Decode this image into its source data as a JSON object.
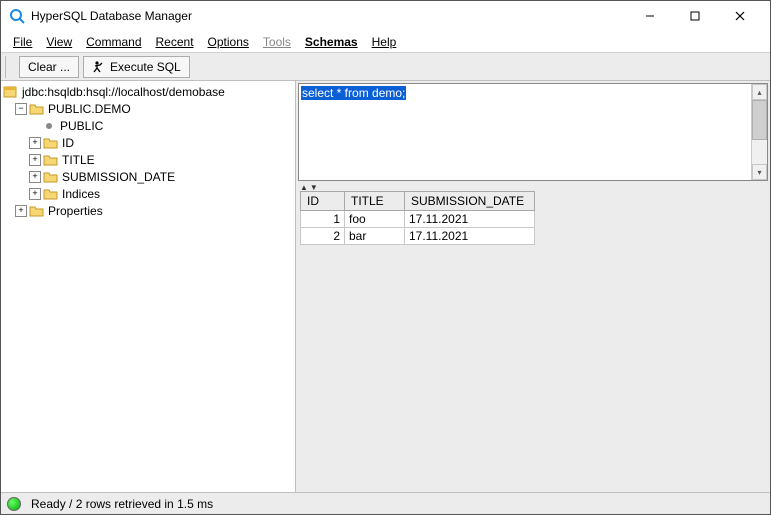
{
  "window": {
    "title": "HyperSQL Database Manager"
  },
  "menu": {
    "file": "File",
    "view": "View",
    "command": "Command",
    "recent": "Recent",
    "options": "Options",
    "tools": "Tools",
    "schemas": "Schemas",
    "help": "Help"
  },
  "toolbar": {
    "clear": "Clear ...",
    "execute": "Execute SQL"
  },
  "tree": {
    "root": "jdbc:hsqldb:hsql://localhost/demobase",
    "schema": "PUBLIC.DEMO",
    "public": "PUBLIC",
    "col_id": "ID",
    "col_title": "TITLE",
    "col_date": "SUBMISSION_DATE",
    "indices": "Indices",
    "properties": "Properties"
  },
  "sql": {
    "query": "select * from demo;"
  },
  "results": {
    "columns": [
      "ID",
      "TITLE",
      "SUBMISSION_DATE"
    ],
    "rows": [
      {
        "id": "1",
        "title": "foo",
        "date": "17.11.2021"
      },
      {
        "id": "2",
        "title": "bar",
        "date": "17.11.2021"
      }
    ]
  },
  "status": {
    "text": "Ready / 2 rows retrieved in 1.5 ms"
  },
  "colors": {
    "selection": "#0a5fd6"
  }
}
